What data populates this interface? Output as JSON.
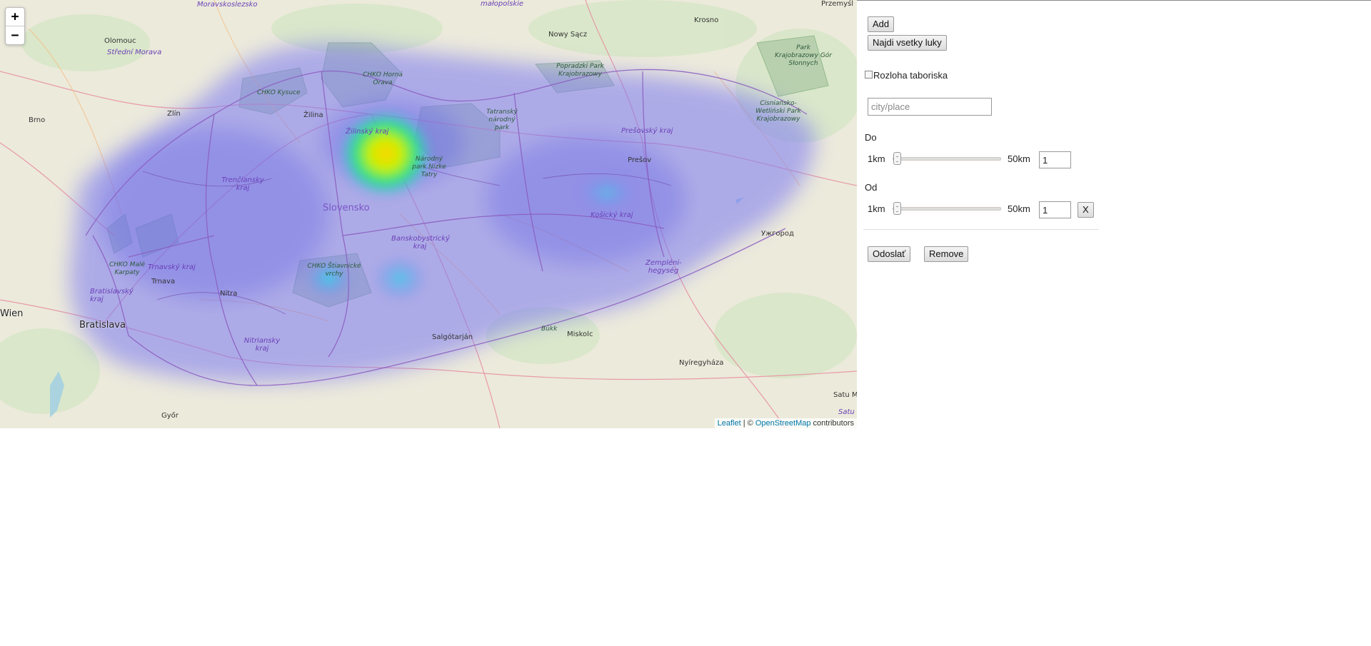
{
  "map": {
    "zoom_in": "+",
    "zoom_out": "−",
    "attribution": {
      "leaflet": "Leaflet",
      "separator": " | © ",
      "osm": "OpenStreetMap",
      "suffix": " contributors"
    },
    "labels": {
      "moravskoslezsko": "Moravskoslezsko",
      "malopolskie": "małopolskie",
      "przemysl": "Przemyśl",
      "krosno": "Krosno",
      "nowy_sacz": "Nowy Sącz",
      "olomouc": "Olomouc",
      "stredni_morava": "Střední Morava",
      "chko_kysuce": "CHKO Kysuce",
      "chko_horna_orava": "CHKO Horná Orava",
      "popradzki": "Popradzki Park Krajobrazowy",
      "park_gor_slonnych": "Park Krajobrazowy Gór Słonnych",
      "brno": "Brno",
      "zlin": "Zlín",
      "zilina": "Žilina",
      "tatransky": "Tatranský národný park",
      "presovsky": "Prešovský kraj",
      "cisnianskie": "Cisniańsko-Wetliński Park Krajobrazowy",
      "zilinsky": "Žilinský kraj",
      "narodny_nizke_tatry": "Národný park Nízke Tatry",
      "presov": "Prešov",
      "trenciansky": "Trenčiansky kraj",
      "slovensko": "Slovensko",
      "kosicky": "Košický kraj",
      "uzhorod": "Ужгород",
      "banskobystricky": "Banskobystrický kraj",
      "chko_male_karpaty": "CHKO Malé Karpaty",
      "trnavsky": "Trnavský kraj",
      "chko_stiavnicke": "CHKO Štiavnické vrchy",
      "zempleni": "Zempléni-hegység",
      "bratislavsky": "Bratislavský kraj",
      "trnava": "Trnava",
      "nitra": "Nitra",
      "wien": "Wien",
      "bratislava": "Bratislava",
      "bukk": "Bükk",
      "miskolc": "Miskolc",
      "salgotarjan": "Salgótarján",
      "nitriansky": "Nitriansky kraj",
      "nyiregyhaza": "Nyíregyháza",
      "gyor": "Győr",
      "satu_m": "Satu M",
      "satu": "Satu"
    },
    "heatmap_points": [
      {
        "lat": 49.12,
        "lon": 19.3,
        "intensity": 1.0
      },
      {
        "lat": 48.58,
        "lon": 18.85,
        "intensity": 0.45
      },
      {
        "lat": 48.55,
        "lon": 19.25,
        "intensity": 0.4
      },
      {
        "lat": 48.75,
        "lon": 21.0,
        "intensity": 0.35
      }
    ],
    "colors": {
      "heat_low": "#6b6bf0",
      "heat_mid": "#29d4e0",
      "heat_high": "#ffe600",
      "region_border": "#8a5cc0",
      "park": "#5c9a5a"
    }
  },
  "panel": {
    "add_button": "Add",
    "find_all_button": "Najdi vsetky luky",
    "camp_checkbox_label": "Rozloha taboriska",
    "camp_checkbox_checked": false,
    "city_placeholder": "city/place",
    "do_label": "Do",
    "od_label": "Od",
    "slider_min_label": "1km",
    "slider_max_label": "50km",
    "do_value": "1",
    "od_value": "1",
    "clear_button": "X",
    "send_button": "Odoslať",
    "remove_button": "Remove"
  }
}
